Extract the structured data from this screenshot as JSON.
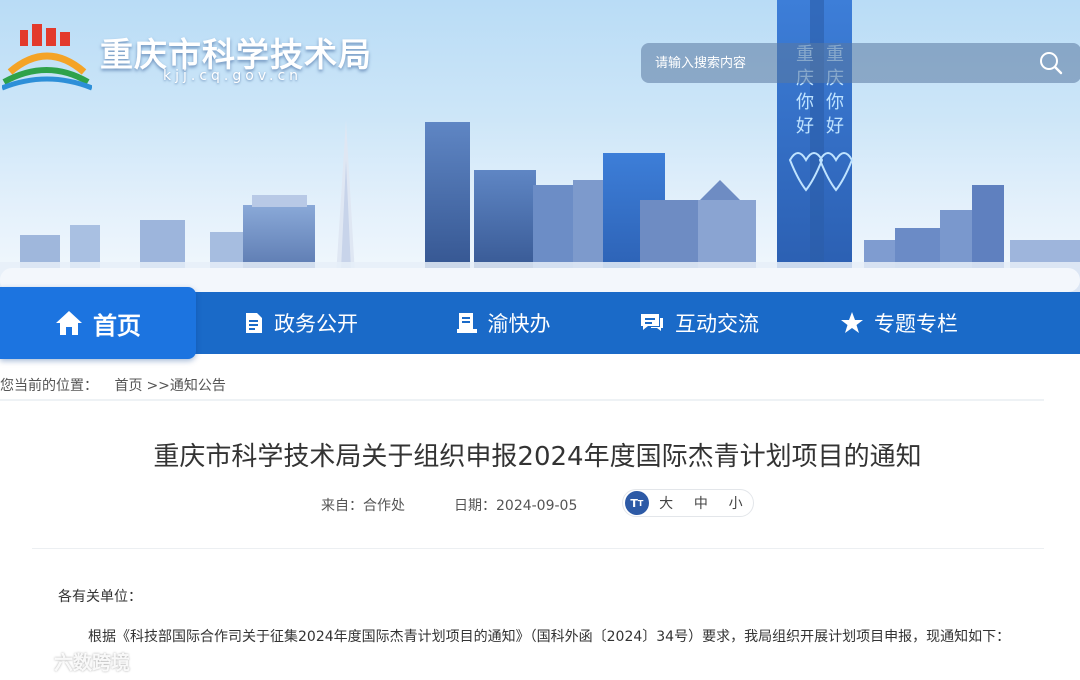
{
  "header": {
    "site_title": "重庆市科学技术局",
    "site_domain": "kjj.cq.gov.cn",
    "search_placeholder": "请输入搜索内容"
  },
  "nav": {
    "items": [
      {
        "label": "首页",
        "icon": "home-icon",
        "active": true
      },
      {
        "label": "政务公开",
        "icon": "document-icon"
      },
      {
        "label": "渝快办",
        "icon": "service-icon"
      },
      {
        "label": "互动交流",
        "icon": "chat-icon"
      },
      {
        "label": "专题专栏",
        "icon": "star-icon"
      }
    ]
  },
  "breadcrumb": {
    "prefix": "您当前的位置：",
    "home": "首页",
    "separator": ">>",
    "current": "通知公告"
  },
  "article": {
    "title": "重庆市科学技术局关于组织申报2024年度国际杰青计划项目的通知",
    "from": "来自：合作处",
    "date": "日期：2024-09-05",
    "font_icon_text": "T",
    "font_sizes": [
      "大",
      "中",
      "小"
    ],
    "salutation": "各有关单位：",
    "paragraph": "根据《科技部国际合作司关于征集2024年度国际杰青计划项目的通知》（国科外函〔2024〕34号）要求，我局组织开展计划项目申报，现通知如下："
  },
  "watermark": {
    "text": "六数跨境"
  },
  "colors": {
    "nav_bg": "#1a6ac8",
    "nav_active": "#1c74e0",
    "text": "#333333"
  }
}
